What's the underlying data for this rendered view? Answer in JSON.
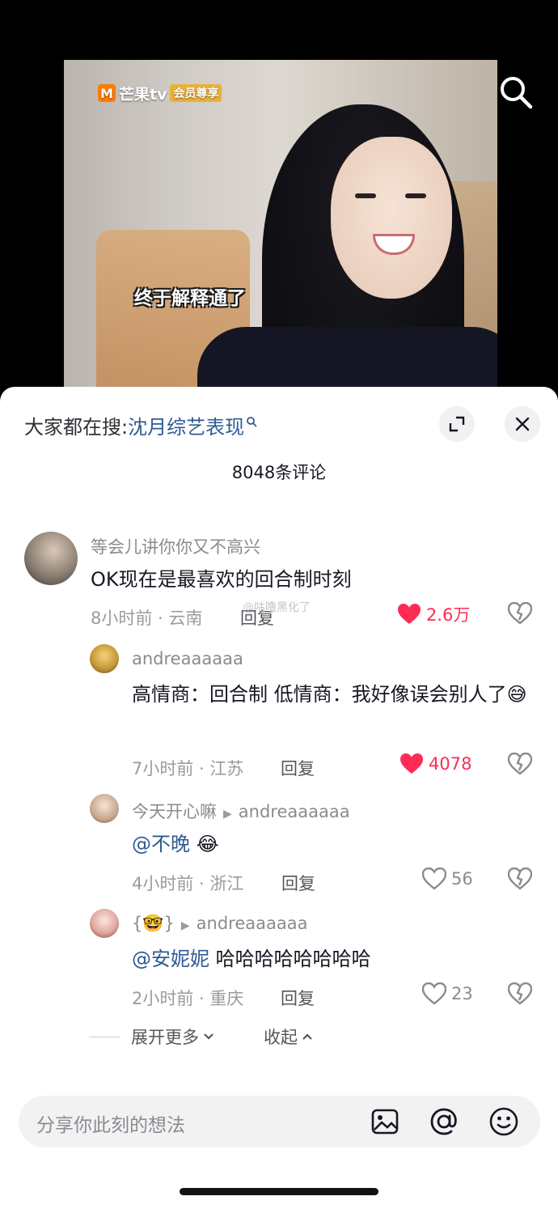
{
  "video": {
    "logo_text": "芒果tv",
    "logo_badge": "会员尊享",
    "subtitle": "终于解释通了"
  },
  "header": {
    "hot_search_prefix": "大家都在搜:",
    "hot_search_term": "沈月综艺表现",
    "comment_count_title": "8048条评论"
  },
  "comments": [
    {
      "username": "等会儿讲你你又不高兴",
      "text": "OK现在是最喜欢的回合制时刻",
      "meta": "8小时前 · 云南",
      "reply_label": "回复",
      "likes": "2.6万"
    },
    {
      "username": "andreaaaaaa",
      "text": "高情商：回合制 低情商：我好像误会别人了😅",
      "meta": "7小时前 · 江苏",
      "reply_label": "回复",
      "likes": "4078"
    },
    {
      "username": "今天开心嘛",
      "reply_to": "andreaaaaaa",
      "mention": "@不晚",
      "text": "😂",
      "meta": "4小时前 · 浙江",
      "reply_label": "回复",
      "likes": "56"
    },
    {
      "username": "{🤓}",
      "reply_to": "andreaaaaaa",
      "mention": "@安妮妮",
      "text": "哈哈哈哈哈哈哈哈",
      "meta": "2小时前 · 重庆",
      "reply_label": "回复",
      "likes": "23"
    }
  ],
  "thread_controls": {
    "expand_more": "展开更多",
    "collapse": "收起"
  },
  "input": {
    "placeholder": "分享你此刻的想法"
  },
  "watermark": "@咕噜黑化了",
  "colors": {
    "accent_red": "#fe2c55",
    "link_blue": "#2f5a94"
  },
  "icons": [
    "search-icon",
    "magnifier-small-icon",
    "expand-icon",
    "close-icon",
    "heart-icon",
    "dislike-icon",
    "image-icon",
    "at-icon",
    "emoji-icon",
    "chevron-down-icon",
    "chevron-up-icon"
  ]
}
